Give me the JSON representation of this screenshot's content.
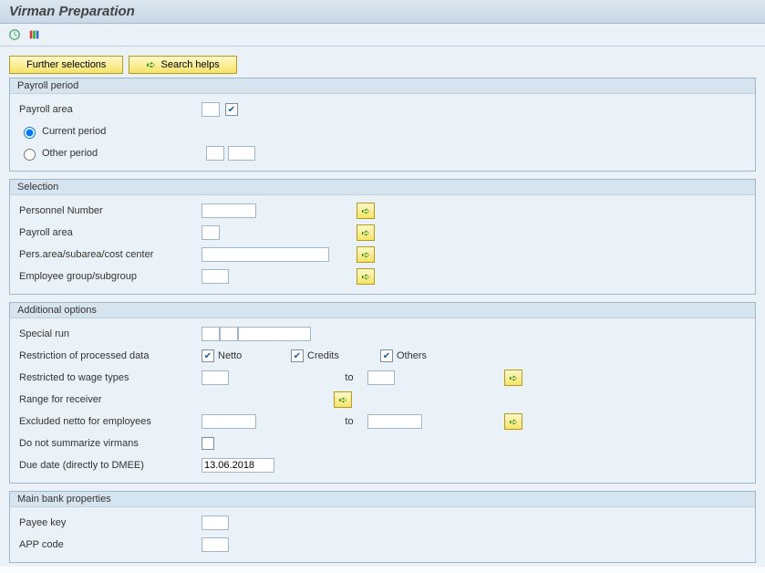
{
  "title": "Virman Preparation",
  "buttons": {
    "further_selections": "Further selections",
    "search_helps": "Search helps"
  },
  "groups": {
    "payroll_period": {
      "title": "Payroll period",
      "payroll_area_label": "Payroll area",
      "current_period": "Current period",
      "other_period": "Other period"
    },
    "selection": {
      "title": "Selection",
      "personnel_number": "Personnel Number",
      "payroll_area": "Payroll area",
      "pers_area": "Pers.area/subarea/cost center",
      "emp_group": "Employee group/subgroup"
    },
    "additional": {
      "title": "Additional options",
      "special_run": "Special run",
      "restriction_label": "Restriction of processed data",
      "netto": "Netto",
      "credits": "Credits",
      "others": "Others",
      "restricted_wage": "Restricted to wage types",
      "range_receiver": "Range for receiver",
      "excluded_netto": "Excluded netto for employees",
      "do_not_summarize": "Do not summarize virmans",
      "due_date_label": "Due date (directly to DMEE)",
      "due_date_value": "13.06.2018",
      "to": "to"
    },
    "bank": {
      "title": "Main bank properties",
      "payee_key": "Payee key",
      "app_code": "APP code"
    }
  }
}
